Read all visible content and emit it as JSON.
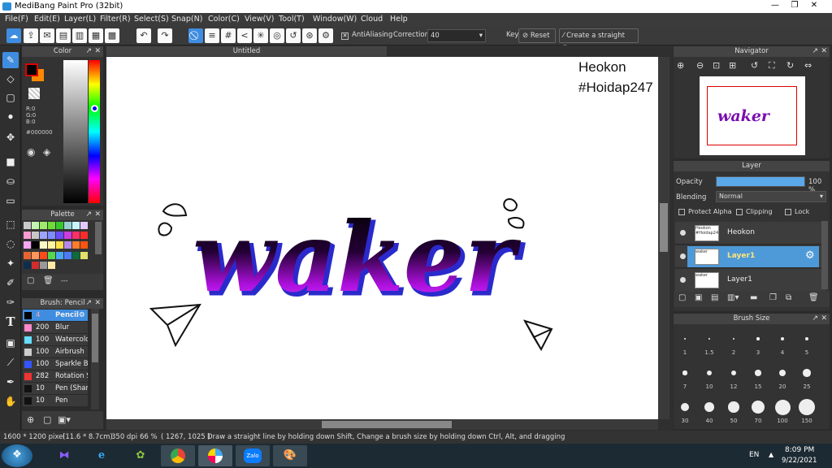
{
  "window": {
    "title": "MediBang Paint Pro (32bit)",
    "minimize": "—",
    "restore": "❐",
    "close": "✕"
  },
  "menu": [
    "File(F)",
    "Edit(E)",
    "Layer(L)",
    "Filter(R)",
    "Select(S)",
    "Snap(N)",
    "Color(C)",
    "View(V)",
    "Tool(T)",
    "Window(W)",
    "Cloud",
    "Help"
  ],
  "toolbar": {
    "antialiasing_label": "AntiAliasing",
    "correction_label": "Correction",
    "correction_value": "40",
    "key_label": "Key",
    "reset_label": "Reset",
    "straight_line_label": "Create a straight line"
  },
  "color_panel": {
    "title": "Color",
    "r": "R:0",
    "g": "G:0",
    "b": "B:0",
    "hex": "#000000",
    "primary": "#000000",
    "secondary": "#ff8800"
  },
  "palette_panel": {
    "title": "Palette",
    "colors": [
      "#c9c9c9",
      "#c3f5b0",
      "#9dec6a",
      "#6fdc3a",
      "#35c92b",
      "#97d1d2",
      "#c9f4ff",
      "#e3c9ff",
      "#ff9ad0",
      "#c7c7c7",
      "#9da3ff",
      "#7e8cff",
      "#6c4cff",
      "#cc3ce0",
      "#ff2e67",
      "#ff2b2b",
      "#f7a5f5",
      "#000000",
      "#fff9c4",
      "#fff2a0",
      "#ffe04a",
      "#b58be7",
      "#ff7c2a",
      "#ff5511",
      "#e76431",
      "#ff965c",
      "#ff4b19",
      "#52d94f",
      "#48a7f2",
      "#4b7bf6",
      "#0d6b3d",
      "#e0e06a",
      "#0f2d4d",
      "#d22c2c",
      "#999999",
      "#ffe9a6"
    ],
    "footer_value": "---"
  },
  "brush_panel": {
    "title": "Brush: Pencil",
    "items": [
      {
        "size": "4",
        "name": "Pencil",
        "color": "#000000",
        "selected": true
      },
      {
        "size": "200",
        "name": "Blur",
        "color": "#ff88cc"
      },
      {
        "size": "100",
        "name": "Watercolor",
        "color": "#66ddff"
      },
      {
        "size": "100",
        "name": "Airbrush",
        "color": "#cccccc"
      },
      {
        "size": "100",
        "name": "Sparkle Brush",
        "color": "#3355ff"
      },
      {
        "size": "282",
        "name": "Rotation Sym",
        "color": "#ee3333"
      },
      {
        "size": "10",
        "name": "Pen (Sharp)",
        "color": "#111111"
      },
      {
        "size": "10",
        "name": "Pen",
        "color": "#111111"
      }
    ]
  },
  "document": {
    "tab_title": "Untitled",
    "watermark_line1": "Heokon",
    "watermark_line2": "#Hoidap247",
    "art_text": "waker"
  },
  "navigator_panel": {
    "title": "Navigator"
  },
  "layer_panel": {
    "title": "Layer",
    "opacity_label": "Opacity",
    "opacity_value": "100 %",
    "opacity_fraction": 1.0,
    "blending_label": "Blending",
    "blending_value": "Normal",
    "protect_alpha_label": "Protect Alpha",
    "clipping_label": "Clipping",
    "lock_label": "Lock",
    "layers": [
      {
        "name": "Heokon",
        "thumb": "Heokon #Hoidap247",
        "selected": false
      },
      {
        "name": "Layer1",
        "thumb": "waker",
        "selected": true
      },
      {
        "name": "Layer1",
        "thumb": "waker",
        "selected": false
      }
    ]
  },
  "brush_size_panel": {
    "title": "Brush Size",
    "sizes": [
      "1",
      "1.5",
      "2",
      "3",
      "4",
      "5",
      "7",
      "10",
      "12",
      "15",
      "20",
      "25",
      "30",
      "40",
      "50",
      "70",
      "100",
      "150"
    ]
  },
  "status": {
    "dimensions": "1600 * 1200 pixel",
    "physical": "(11.6 * 8.7cm)",
    "dpi": "350 dpi",
    "zoom": "66 %",
    "coords": "( 1267, 1025 )",
    "hint": "Draw a straight line by holding down Shift, Change a brush size by holding down Ctrl, Alt, and dragging"
  },
  "taskbar": {
    "lang": "EN",
    "time": "8:09 PM",
    "date": "9/22/2021",
    "zalo_label": "Zalo"
  }
}
